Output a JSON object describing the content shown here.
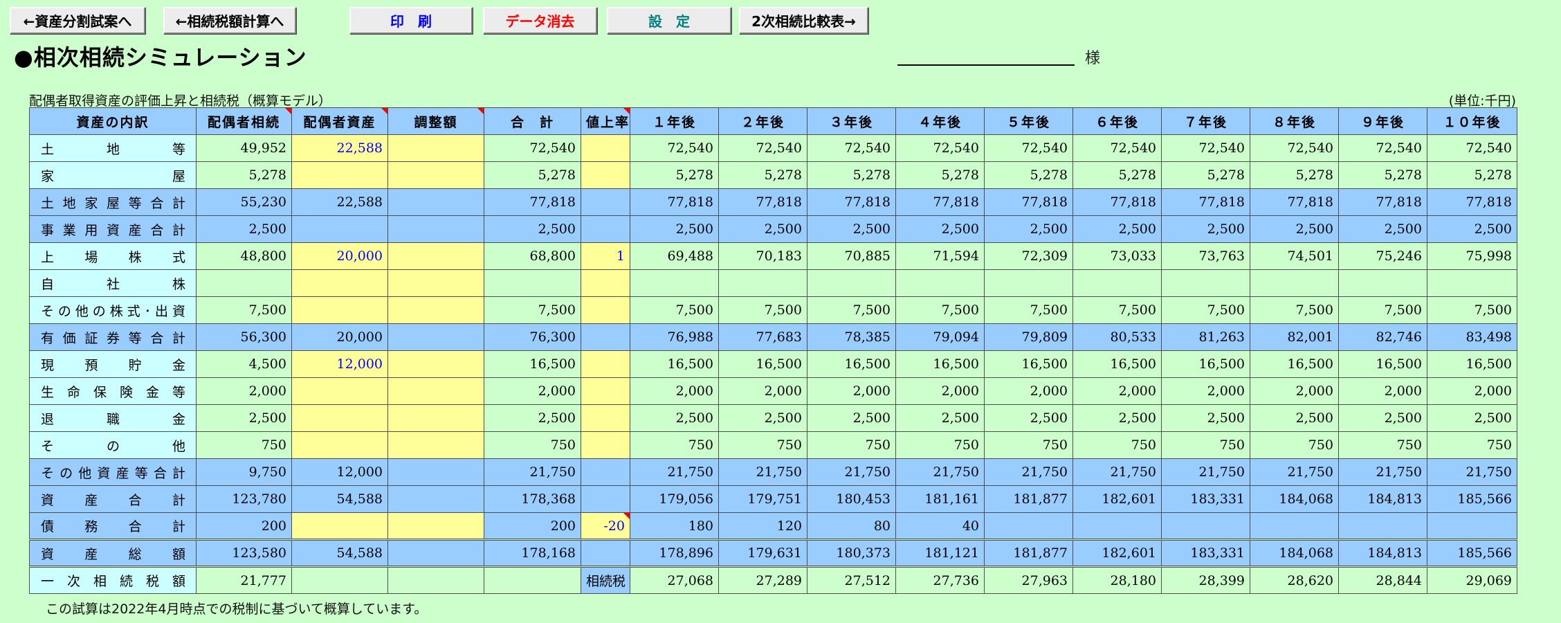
{
  "toolbar": {
    "btn_asset_split": "←資産分割試案へ",
    "btn_tax_calc": "←相続税額計算へ",
    "btn_print": "印　刷",
    "btn_clear": "データ消去",
    "btn_settings": "設　定",
    "btn_compare": "2次相続比較表→"
  },
  "colors": {
    "background": "#ccffcc",
    "header": "#99ccff",
    "input_cell": "#ffff99",
    "label_cell": "#ccffff",
    "print_text": "#0000ff",
    "clear_text": "#ff0000",
    "settings_text": "#008080"
  },
  "page": {
    "title": "●相次相続シミュレーション",
    "honorific": "様",
    "subtitle": "配偶者取得資産の評価上昇と相続税（概算モデル）",
    "unit": "(単位:千円)",
    "note": "この試算は2022年4月時点での税制に基づいて概算しています。"
  },
  "table": {
    "headers": [
      "資産の内訳",
      "配偶者相続",
      "配偶者資産",
      "調整額",
      "合　計",
      "値上率",
      "１年後",
      "２年後",
      "３年後",
      "４年後",
      "５年後",
      "６年後",
      "７年後",
      "８年後",
      "９年後",
      "１０年後"
    ],
    "rows": [
      {
        "label": "土地等",
        "cells": [
          "49,952",
          "22,588",
          "",
          "72,540",
          "",
          "72,540",
          "72,540",
          "72,540",
          "72,540",
          "72,540",
          "72,540",
          "72,540",
          "72,540",
          "72,540",
          "72,540"
        ]
      },
      {
        "label": "家屋",
        "cells": [
          "5,278",
          "",
          "",
          "5,278",
          "",
          "5,278",
          "5,278",
          "5,278",
          "5,278",
          "5,278",
          "5,278",
          "5,278",
          "5,278",
          "5,278",
          "5,278"
        ]
      },
      {
        "label": "土地家屋等合計",
        "cells": [
          "55,230",
          "22,588",
          "",
          "77,818",
          "",
          "77,818",
          "77,818",
          "77,818",
          "77,818",
          "77,818",
          "77,818",
          "77,818",
          "77,818",
          "77,818",
          "77,818"
        ]
      },
      {
        "label": "事業用資産合計",
        "cells": [
          "2,500",
          "",
          "",
          "2,500",
          "",
          "2,500",
          "2,500",
          "2,500",
          "2,500",
          "2,500",
          "2,500",
          "2,500",
          "2,500",
          "2,500",
          "2,500"
        ]
      },
      {
        "label": "上場株式",
        "cells": [
          "48,800",
          "20,000",
          "",
          "68,800",
          "1",
          "69,488",
          "70,183",
          "70,885",
          "71,594",
          "72,309",
          "73,033",
          "73,763",
          "74,501",
          "75,246",
          "75,998"
        ]
      },
      {
        "label": "自社株",
        "cells": [
          "",
          "",
          "",
          "",
          "",
          "",
          "",
          "",
          "",
          "",
          "",
          "",
          "",
          "",
          ""
        ]
      },
      {
        "label": "その他の株式･出資",
        "cells": [
          "7,500",
          "",
          "",
          "7,500",
          "",
          "7,500",
          "7,500",
          "7,500",
          "7,500",
          "7,500",
          "7,500",
          "7,500",
          "7,500",
          "7,500",
          "7,500"
        ]
      },
      {
        "label": "有価証券等合計",
        "cells": [
          "56,300",
          "20,000",
          "",
          "76,300",
          "",
          "76,988",
          "77,683",
          "78,385",
          "79,094",
          "79,809",
          "80,533",
          "81,263",
          "82,001",
          "82,746",
          "83,498"
        ]
      },
      {
        "label": "現預貯金",
        "cells": [
          "4,500",
          "12,000",
          "",
          "16,500",
          "",
          "16,500",
          "16,500",
          "16,500",
          "16,500",
          "16,500",
          "16,500",
          "16,500",
          "16,500",
          "16,500",
          "16,500"
        ]
      },
      {
        "label": "生命保険金等",
        "cells": [
          "2,000",
          "",
          "",
          "2,000",
          "",
          "2,000",
          "2,000",
          "2,000",
          "2,000",
          "2,000",
          "2,000",
          "2,000",
          "2,000",
          "2,000",
          "2,000"
        ]
      },
      {
        "label": "退職金",
        "cells": [
          "2,500",
          "",
          "",
          "2,500",
          "",
          "2,500",
          "2,500",
          "2,500",
          "2,500",
          "2,500",
          "2,500",
          "2,500",
          "2,500",
          "2,500",
          "2,500"
        ]
      },
      {
        "label": "その他",
        "cells": [
          "750",
          "",
          "",
          "750",
          "",
          "750",
          "750",
          "750",
          "750",
          "750",
          "750",
          "750",
          "750",
          "750",
          "750"
        ]
      },
      {
        "label": "その他資産等合計",
        "cells": [
          "9,750",
          "12,000",
          "",
          "21,750",
          "",
          "21,750",
          "21,750",
          "21,750",
          "21,750",
          "21,750",
          "21,750",
          "21,750",
          "21,750",
          "21,750",
          "21,750"
        ]
      },
      {
        "label": "資産合計",
        "cells": [
          "123,780",
          "54,588",
          "",
          "178,368",
          "",
          "179,056",
          "179,751",
          "180,453",
          "181,161",
          "181,877",
          "182,601",
          "183,331",
          "184,068",
          "184,813",
          "185,566"
        ]
      },
      {
        "label": "債務合計",
        "cells": [
          "200",
          "",
          "",
          "200",
          "-20",
          "180",
          "120",
          "80",
          "40",
          "",
          "",
          "",
          "",
          "",
          ""
        ]
      },
      {
        "label": "資産総額",
        "cells": [
          "123,580",
          "54,588",
          "",
          "178,168",
          "",
          "178,896",
          "179,631",
          "180,373",
          "181,121",
          "181,877",
          "182,601",
          "183,331",
          "184,068",
          "184,813",
          "185,566"
        ]
      },
      {
        "label": "一次相続税額",
        "cells": [
          "21,777",
          "",
          "",
          "",
          "相続税",
          "27,068",
          "27,289",
          "27,512",
          "27,736",
          "27,963",
          "28,180",
          "28,399",
          "28,620",
          "28,844",
          "29,069"
        ]
      }
    ]
  }
}
